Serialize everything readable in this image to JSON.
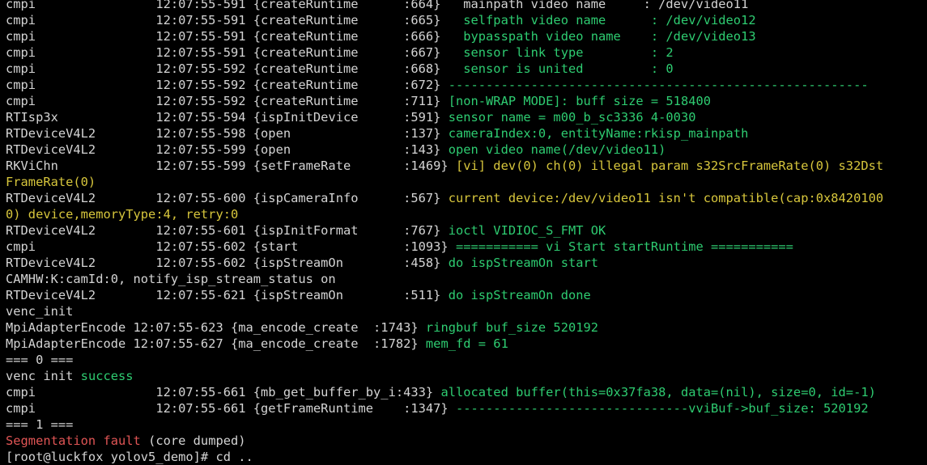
{
  "colors": {
    "background": "#000000",
    "text": "#d4d4d4",
    "green": "#2ecc71",
    "yellow": "#d7c63c",
    "red": "#e05555"
  },
  "lines": [
    {
      "segs": [
        {
          "t": "cmpi                12:07:55-591 {createRuntime      :664}   mainpath video name     : /dev/video11",
          "c": "white"
        }
      ]
    },
    {
      "segs": [
        {
          "t": "cmpi                12:07:55-591 {createRuntime      :665}   ",
          "c": "white"
        },
        {
          "t": "selfpath video name      : /dev/video12",
          "c": "green"
        }
      ]
    },
    {
      "segs": [
        {
          "t": "cmpi                12:07:55-591 {createRuntime      :666}   ",
          "c": "white"
        },
        {
          "t": "bypasspath video name    : /dev/video13",
          "c": "green"
        }
      ]
    },
    {
      "segs": [
        {
          "t": "cmpi                12:07:55-591 {createRuntime      :667}   ",
          "c": "white"
        },
        {
          "t": "sensor link type         : 2",
          "c": "green"
        }
      ]
    },
    {
      "segs": [
        {
          "t": "cmpi                12:07:55-592 {createRuntime      :668}   ",
          "c": "white"
        },
        {
          "t": "sensor is united         : 0",
          "c": "green"
        }
      ]
    },
    {
      "segs": [
        {
          "t": "cmpi                12:07:55-592 {createRuntime      :672} ",
          "c": "white"
        },
        {
          "t": "--------------------------------------------------------",
          "c": "green"
        }
      ]
    },
    {
      "segs": [
        {
          "t": "cmpi                12:07:55-592 {createRuntime      :711} ",
          "c": "white"
        },
        {
          "t": "[non-WRAP MODE]: buff size = 518400",
          "c": "green"
        }
      ]
    },
    {
      "segs": [
        {
          "t": "RTIsp3x             12:07:55-594 {ispInitDevice      :591} ",
          "c": "white"
        },
        {
          "t": "sensor name = m00_b_sc3336 4-0030",
          "c": "green"
        }
      ]
    },
    {
      "segs": [
        {
          "t": "RTDeviceV4L2        12:07:55-598 {open               :137} ",
          "c": "white"
        },
        {
          "t": "cameraIndex:0, entityName:rkisp_mainpath",
          "c": "green"
        }
      ]
    },
    {
      "segs": [
        {
          "t": "RTDeviceV4L2        12:07:55-599 {open               :143} ",
          "c": "white"
        },
        {
          "t": "open video name(/dev/video11)",
          "c": "green"
        }
      ]
    },
    {
      "segs": [
        {
          "t": "RKViChn             12:07:55-599 {setFrameRate       :1469} ",
          "c": "white"
        },
        {
          "t": "[vi] dev(0) ch(0) illegal param s32SrcFrameRate(0) s32Dst",
          "c": "yellow"
        }
      ]
    },
    {
      "segs": [
        {
          "t": "FrameRate(0)",
          "c": "yellow"
        }
      ]
    },
    {
      "segs": [
        {
          "t": "RTDeviceV4L2        12:07:55-600 {ispCameraInfo      :567} ",
          "c": "white"
        },
        {
          "t": "current device:/dev/video11 isn't compatible(cap:0x8420100",
          "c": "yellow"
        }
      ]
    },
    {
      "segs": [
        {
          "t": "0) device,memoryType:4, retry:0",
          "c": "yellow"
        }
      ]
    },
    {
      "segs": [
        {
          "t": "RTDeviceV4L2        12:07:55-601 {ispInitFormat      :767} ",
          "c": "white"
        },
        {
          "t": "ioctl VIDIOC_S_FMT OK",
          "c": "green"
        }
      ]
    },
    {
      "segs": [
        {
          "t": "cmpi                12:07:55-602 {start              :1093} ",
          "c": "white"
        },
        {
          "t": "=========== vi Start startRuntime ===========",
          "c": "green"
        }
      ]
    },
    {
      "segs": [
        {
          "t": "RTDeviceV4L2        12:07:55-602 {ispStreamOn        :458} ",
          "c": "white"
        },
        {
          "t": "do ispStreamOn start",
          "c": "green"
        }
      ]
    },
    {
      "segs": [
        {
          "t": "CAMHW:K:camId:0, notify_isp_stream_status on",
          "c": "white"
        }
      ]
    },
    {
      "segs": [
        {
          "t": "RTDeviceV4L2        12:07:55-621 {ispStreamOn        :511} ",
          "c": "white"
        },
        {
          "t": "do ispStreamOn done",
          "c": "green"
        }
      ]
    },
    {
      "segs": [
        {
          "t": "venc_init",
          "c": "white"
        }
      ]
    },
    {
      "segs": [
        {
          "t": "MpiAdapterEncode 12:07:55-623 {ma_encode_create  :1743} ",
          "c": "white"
        },
        {
          "t": "ringbuf buf_size 520192",
          "c": "green"
        }
      ]
    },
    {
      "segs": [
        {
          "t": "MpiAdapterEncode 12:07:55-627 {ma_encode_create  :1782} ",
          "c": "white"
        },
        {
          "t": "mem_fd = 61",
          "c": "green"
        }
      ]
    },
    {
      "segs": [
        {
          "t": "=== 0 ===",
          "c": "white"
        }
      ]
    },
    {
      "segs": [
        {
          "t": "venc init ",
          "c": "white"
        },
        {
          "t": "success",
          "c": "green"
        }
      ]
    },
    {
      "segs": [
        {
          "t": "cmpi                12:07:55-661 {mb_get_buffer_by_i:433} ",
          "c": "white"
        },
        {
          "t": "allocated buffer(this=0x37fa38, data=(nil), size=0, id=-1)",
          "c": "green"
        }
      ]
    },
    {
      "segs": [
        {
          "t": "cmpi                12:07:55-661 {getFrameRuntime    :1347} ",
          "c": "white"
        },
        {
          "t": "-------------------------------vviBuf->buf_size: 520192",
          "c": "green"
        }
      ]
    },
    {
      "segs": [
        {
          "t": "=== 1 ===",
          "c": "white"
        }
      ]
    },
    {
      "segs": [
        {
          "t": "Segmentation fault",
          "c": "red"
        },
        {
          "t": " (core dumped)",
          "c": "white"
        }
      ]
    },
    {
      "segs": [
        {
          "t": "[root@luckfox yolov5_demo]# cd ..",
          "c": "white"
        }
      ]
    }
  ]
}
